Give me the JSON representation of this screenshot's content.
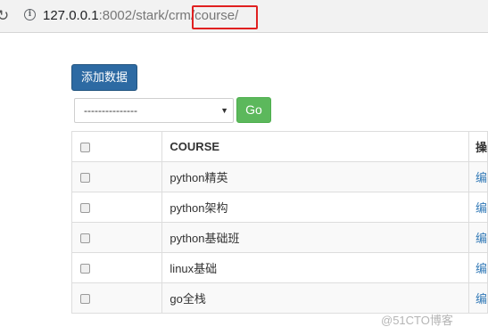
{
  "browser": {
    "reload_icon": "reload-icon",
    "info_icon": "info-icon",
    "url_host": "127.0.0.1",
    "url_port_path": ":8002/stark/crm",
    "url_separator": "/",
    "url_highlight": "course/",
    "highlight_color": "#e02020"
  },
  "toolbar": {
    "add_label": "添加数据",
    "add_color": "#2d6aa3",
    "select_value": "---------------",
    "select_arrow": "▼",
    "go_label": "Go",
    "go_color": "#5cb85c"
  },
  "table": {
    "header_course": "COURSE",
    "header_op": "操",
    "rows": [
      {
        "course": "python精英",
        "op": "编"
      },
      {
        "course": "python架构",
        "op": "编"
      },
      {
        "course": "python基础班",
        "op": "编"
      },
      {
        "course": "linux基础",
        "op": "编"
      },
      {
        "course": "go全栈",
        "op": "编"
      }
    ]
  },
  "watermark": "@51CTO博客"
}
